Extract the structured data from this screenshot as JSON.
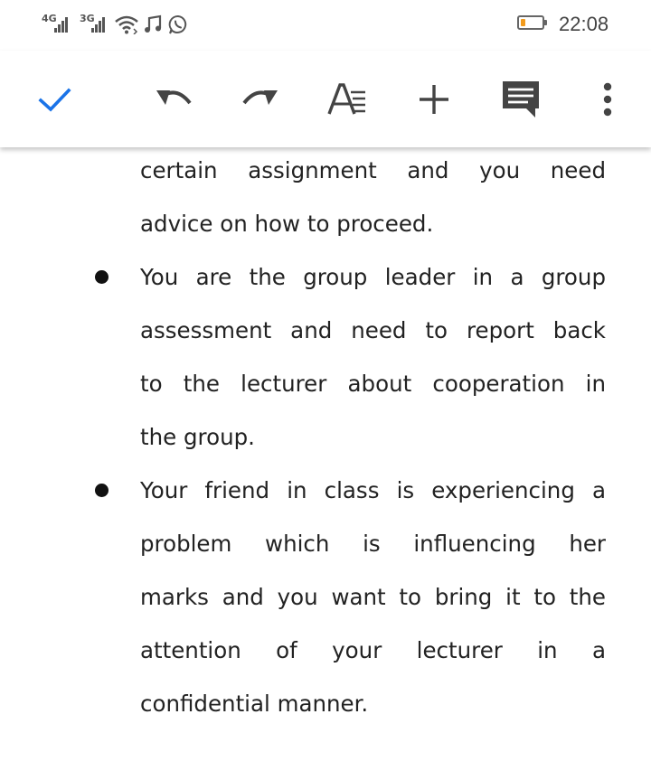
{
  "status_bar": {
    "network_1": "4G",
    "network_2": "3G",
    "icons": [
      "signal-icon",
      "signal-icon",
      "wifi-icon",
      "music-note-icon",
      "whatsapp-icon",
      "battery-icon"
    ],
    "battery_color": "#f29b1d",
    "time": "22:08"
  },
  "toolbar": {
    "icons": [
      "check-icon",
      "undo-icon",
      "redo-icon",
      "text-format-icon",
      "add-icon",
      "comment-icon",
      "more-vert-icon"
    ],
    "accent": "#1a73e8"
  },
  "document": {
    "lines": [
      "certain assignment and you need",
      "advice on how to proceed.",
      "You are the group leader in a group",
      "assessment and need to report back",
      "to the lecturer about cooperation in",
      "the group.",
      "Your friend in class is experiencing a",
      "problem which is influencing her",
      "marks and you want to bring it to the",
      "attention of your lecturer in a",
      "confidential manner."
    ]
  }
}
